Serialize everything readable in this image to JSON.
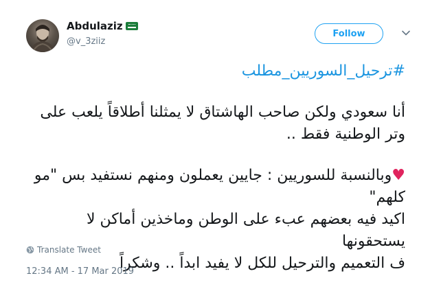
{
  "user": {
    "name": "Abdulaziz",
    "handle": "@v_3ziiz",
    "avatar_icon": "profile-photo"
  },
  "follow": {
    "label": "Follow"
  },
  "tweet": {
    "hashtag": "#ترحيل_السوريين_مطلب",
    "paragraph1": "أنا سعودي ولكن صاحب الهاشتاق لا يمثلنا أطلاقاً يلعب على\nوتر الوطنية فقط ..",
    "paragraph2": "وبالنسبة للسوريين : جايين يعملون ومنهم نستفيد بس \"مو كلهم\"\nاكيد فيه بعضهم عبء على الوطن وماخذين أماكن لا يستحقونها\nف التعميم والترحيل للكل لا يفيد ابداً .. وشكراً",
    "heart_emoji": "♥"
  },
  "translate": {
    "label": "Translate Tweet"
  },
  "timestamp": "12:34 AM - 17 Mar 2019",
  "colors": {
    "link": "#1b95e0",
    "follow": "#1da1f2",
    "secondary": "#657786",
    "heart": "#e0245e",
    "flag": "#1b7d3a"
  },
  "icons": [
    "saudi-flag-emoji",
    "chevron-down-icon",
    "globe-icon",
    "heart-emoji"
  ]
}
